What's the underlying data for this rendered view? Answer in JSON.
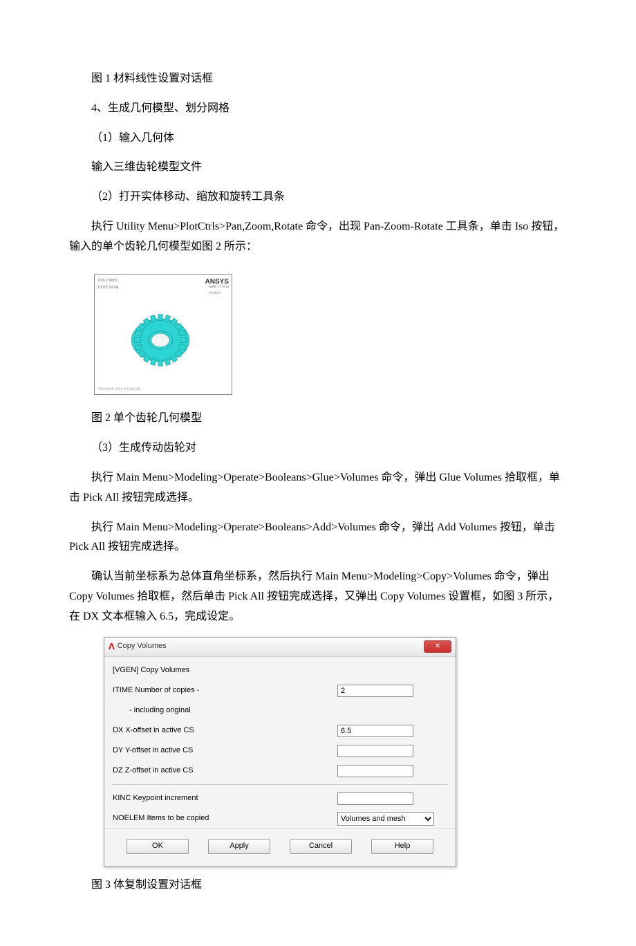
{
  "paragraphs": {
    "fig1_caption": "图 1 材料线性设置对话框",
    "step4": "4、生成几何模型、划分网格",
    "sub1": "（1）输入几何体",
    "sub1_body": "输入三维齿轮模型文件",
    "sub2": "（2）打开实体移动、缩放和旋转工具条",
    "sub2_body": "执行 Utility Menu>PlotCtrls>Pan,Zoom,Rotate 命令，出现 Pan-Zoom-Rotate 工具条，单击 Iso 按钮，输入的单个齿轮几何模型如图 2 所示：",
    "fig2_caption": "图 2 单个齿轮几何模型",
    "sub3": "（3）生成传动齿轮对",
    "sub3_p1": "执行 Main Menu>Modeling>Operate>Booleans>Glue>Volumes 命令，弹出 Glue Volumes 拾取框，单击 Pick All 按钮完成选择。",
    "sub3_p2": "执行 Main Menu>Modeling>Operate>Booleans>Add>Volumes 命令，弹出 Add Volumes 按钮，单击 Pick All 按钮完成选择。",
    "sub3_p3": "确认当前坐标系为总体直角坐标系，然后执行 Main Menu>Modeling>Copy>Volumes 命令，弹出 Copy Volumes 拾取框，然后单击 Pick All 按钮完成选择，又弹出 Copy Volumes 设置框，如图 3 所示，在 DX 文本框输入 6.5，完成设定。",
    "fig3_caption": "图 3 体复制设置对话框"
  },
  "gear_shot": {
    "brand": "ANSYS",
    "top_left1": "VOLUMES",
    "top_left2": "TYPE NUM",
    "date_line1": "MAR 17 2014",
    "date_line2": "10:29:41",
    "bottom": "JOBNAME=FILE  WORKDIR"
  },
  "dialog": {
    "title": "Copy Volumes",
    "header_cmd": "[VGEN]  Copy Volumes",
    "itime_label": "ITIME   Number of copies -",
    "itime_value": "2",
    "including": "- including original",
    "dx_label": "DX     X-offset in active CS",
    "dx_value": "6.5",
    "dy_label": "DY     Y-offset in active CS",
    "dy_value": "",
    "dz_label": "DZ     Z-offset in active CS",
    "dz_value": "",
    "kinc_label": "KINC   Keypoint increment",
    "kinc_value": "",
    "noelem_label": "NOELEM  Items to be copied",
    "noelem_value": "Volumes and mesh",
    "buttons": {
      "ok": "OK",
      "apply": "Apply",
      "cancel": "Cancel",
      "help": "Help"
    }
  }
}
